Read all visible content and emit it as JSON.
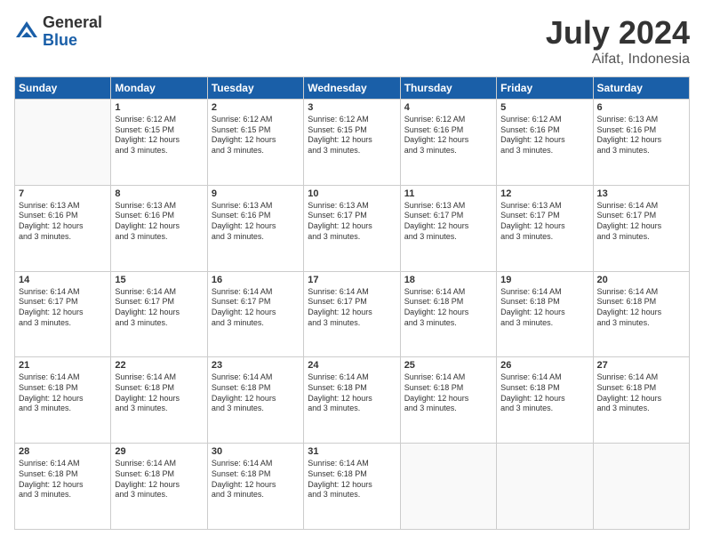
{
  "logo": {
    "general": "General",
    "blue": "Blue"
  },
  "header": {
    "month_year": "July 2024",
    "location": "Aifat, Indonesia"
  },
  "days_of_week": [
    "Sunday",
    "Monday",
    "Tuesday",
    "Wednesday",
    "Thursday",
    "Friday",
    "Saturday"
  ],
  "weeks": [
    [
      {
        "day": "",
        "info": ""
      },
      {
        "day": "1",
        "info": "Sunrise: 6:12 AM\nSunset: 6:15 PM\nDaylight: 12 hours\nand 3 minutes."
      },
      {
        "day": "2",
        "info": "Sunrise: 6:12 AM\nSunset: 6:15 PM\nDaylight: 12 hours\nand 3 minutes."
      },
      {
        "day": "3",
        "info": "Sunrise: 6:12 AM\nSunset: 6:15 PM\nDaylight: 12 hours\nand 3 minutes."
      },
      {
        "day": "4",
        "info": "Sunrise: 6:12 AM\nSunset: 6:16 PM\nDaylight: 12 hours\nand 3 minutes."
      },
      {
        "day": "5",
        "info": "Sunrise: 6:12 AM\nSunset: 6:16 PM\nDaylight: 12 hours\nand 3 minutes."
      },
      {
        "day": "6",
        "info": "Sunrise: 6:13 AM\nSunset: 6:16 PM\nDaylight: 12 hours\nand 3 minutes."
      }
    ],
    [
      {
        "day": "7",
        "info": "Sunrise: 6:13 AM\nSunset: 6:16 PM\nDaylight: 12 hours\nand 3 minutes."
      },
      {
        "day": "8",
        "info": "Sunrise: 6:13 AM\nSunset: 6:16 PM\nDaylight: 12 hours\nand 3 minutes."
      },
      {
        "day": "9",
        "info": "Sunrise: 6:13 AM\nSunset: 6:16 PM\nDaylight: 12 hours\nand 3 minutes."
      },
      {
        "day": "10",
        "info": "Sunrise: 6:13 AM\nSunset: 6:17 PM\nDaylight: 12 hours\nand 3 minutes."
      },
      {
        "day": "11",
        "info": "Sunrise: 6:13 AM\nSunset: 6:17 PM\nDaylight: 12 hours\nand 3 minutes."
      },
      {
        "day": "12",
        "info": "Sunrise: 6:13 AM\nSunset: 6:17 PM\nDaylight: 12 hours\nand 3 minutes."
      },
      {
        "day": "13",
        "info": "Sunrise: 6:14 AM\nSunset: 6:17 PM\nDaylight: 12 hours\nand 3 minutes."
      }
    ],
    [
      {
        "day": "14",
        "info": "Sunrise: 6:14 AM\nSunset: 6:17 PM\nDaylight: 12 hours\nand 3 minutes."
      },
      {
        "day": "15",
        "info": "Sunrise: 6:14 AM\nSunset: 6:17 PM\nDaylight: 12 hours\nand 3 minutes."
      },
      {
        "day": "16",
        "info": "Sunrise: 6:14 AM\nSunset: 6:17 PM\nDaylight: 12 hours\nand 3 minutes."
      },
      {
        "day": "17",
        "info": "Sunrise: 6:14 AM\nSunset: 6:17 PM\nDaylight: 12 hours\nand 3 minutes."
      },
      {
        "day": "18",
        "info": "Sunrise: 6:14 AM\nSunset: 6:18 PM\nDaylight: 12 hours\nand 3 minutes."
      },
      {
        "day": "19",
        "info": "Sunrise: 6:14 AM\nSunset: 6:18 PM\nDaylight: 12 hours\nand 3 minutes."
      },
      {
        "day": "20",
        "info": "Sunrise: 6:14 AM\nSunset: 6:18 PM\nDaylight: 12 hours\nand 3 minutes."
      }
    ],
    [
      {
        "day": "21",
        "info": "Sunrise: 6:14 AM\nSunset: 6:18 PM\nDaylight: 12 hours\nand 3 minutes."
      },
      {
        "day": "22",
        "info": "Sunrise: 6:14 AM\nSunset: 6:18 PM\nDaylight: 12 hours\nand 3 minutes."
      },
      {
        "day": "23",
        "info": "Sunrise: 6:14 AM\nSunset: 6:18 PM\nDaylight: 12 hours\nand 3 minutes."
      },
      {
        "day": "24",
        "info": "Sunrise: 6:14 AM\nSunset: 6:18 PM\nDaylight: 12 hours\nand 3 minutes."
      },
      {
        "day": "25",
        "info": "Sunrise: 6:14 AM\nSunset: 6:18 PM\nDaylight: 12 hours\nand 3 minutes."
      },
      {
        "day": "26",
        "info": "Sunrise: 6:14 AM\nSunset: 6:18 PM\nDaylight: 12 hours\nand 3 minutes."
      },
      {
        "day": "27",
        "info": "Sunrise: 6:14 AM\nSunset: 6:18 PM\nDaylight: 12 hours\nand 3 minutes."
      }
    ],
    [
      {
        "day": "28",
        "info": "Sunrise: 6:14 AM\nSunset: 6:18 PM\nDaylight: 12 hours\nand 3 minutes."
      },
      {
        "day": "29",
        "info": "Sunrise: 6:14 AM\nSunset: 6:18 PM\nDaylight: 12 hours\nand 3 minutes."
      },
      {
        "day": "30",
        "info": "Sunrise: 6:14 AM\nSunset: 6:18 PM\nDaylight: 12 hours\nand 3 minutes."
      },
      {
        "day": "31",
        "info": "Sunrise: 6:14 AM\nSunset: 6:18 PM\nDaylight: 12 hours\nand 3 minutes."
      },
      {
        "day": "",
        "info": ""
      },
      {
        "day": "",
        "info": ""
      },
      {
        "day": "",
        "info": ""
      }
    ]
  ]
}
